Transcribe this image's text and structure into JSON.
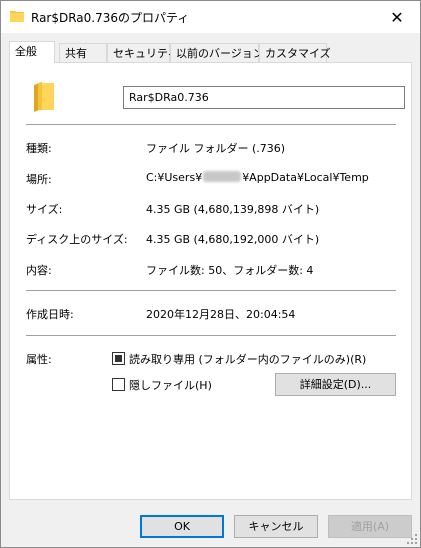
{
  "window": {
    "title": "Rar$DRa0.736のプロパティ",
    "close_glyph": "✕"
  },
  "tabs": [
    {
      "label": "全般",
      "active": true
    },
    {
      "label": "共有",
      "active": false
    },
    {
      "label": "セキュリティ",
      "active": false
    },
    {
      "label": "以前のバージョン",
      "active": false
    },
    {
      "label": "カスタマイズ",
      "active": false
    }
  ],
  "general": {
    "name_value": "Rar$DRa0.736",
    "type_label": "種類:",
    "type_value": "ファイル フォルダー (.736)",
    "location_label": "場所:",
    "location_prefix": "C:¥Users¥",
    "location_suffix": "¥AppData¥Local¥Temp",
    "size_label": "サイズ:",
    "size_value": "4.35 GB (4,680,139,898 バイト)",
    "disk_size_label": "ディスク上のサイズ:",
    "disk_size_value": "4.35 GB (4,680,192,000 バイト)",
    "contents_label": "内容:",
    "contents_value": "ファイル数: 50、フォルダー数: 4",
    "created_label": "作成日時:",
    "created_value": "2020年12月28日、20:04:54",
    "attributes_label": "属性:",
    "readonly_label": "読み取り専用 (フォルダー内のファイルのみ)(R)",
    "hidden_label": "隠しファイル(H)",
    "advanced_button": "詳細設定(D)..."
  },
  "footer": {
    "ok": "OK",
    "cancel": "キャンセル",
    "apply": "適用(A)"
  },
  "colors": {
    "folder": "#f5c43c",
    "accent": "#0078d7"
  }
}
